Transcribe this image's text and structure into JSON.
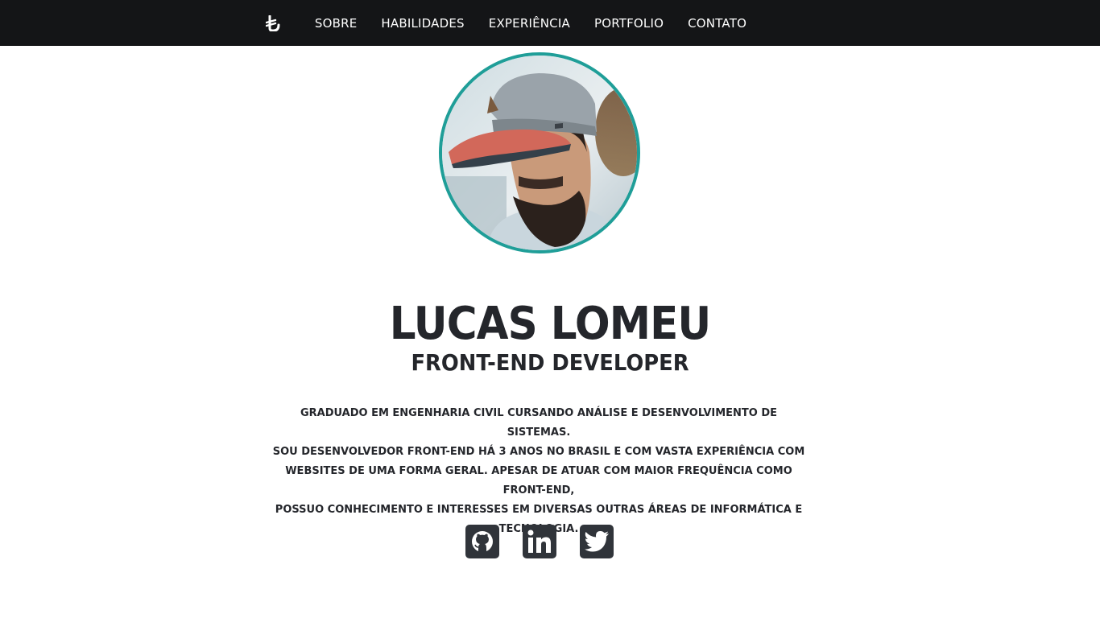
{
  "nav": {
    "logo_icon": "lira-logo-icon",
    "items": [
      {
        "label": "SOBRE"
      },
      {
        "label": "HABILIDADES"
      },
      {
        "label": "EXPERIÊNCIA"
      },
      {
        "label": "PORTFOLIO"
      },
      {
        "label": "CONTATO"
      }
    ]
  },
  "profile": {
    "photo": "profile-photo",
    "accent_color": "#1f9e98"
  },
  "hero": {
    "name": "LUCAS LOMEU",
    "role": "FRONT-END DEVELOPER"
  },
  "bio": {
    "lines": [
      "GRADUADO EM ENGENHARIA CIVIL CURSANDO ANÁLISE E DESENVOLVIMENTO DE SISTEMAS.",
      "SOU DESENVOLVEDOR FRONT-END HÁ 3 ANOS NO BRASIL E COM VASTA EXPERIÊNCIA COM",
      "WEBSITES DE UMA FORMA GERAL. APESAR DE ATUAR COM MAIOR FREQUÊNCIA COMO FRONT-END,",
      "POSSUO CONHECIMENTO E INTERESSES EM DIVERSAS OUTRAS ÁREAS DE INFORMÁTICA E",
      "TECNOLOGIA."
    ]
  },
  "socials": [
    {
      "icon": "github-icon"
    },
    {
      "icon": "linkedin-icon"
    },
    {
      "icon": "twitter-icon"
    }
  ]
}
